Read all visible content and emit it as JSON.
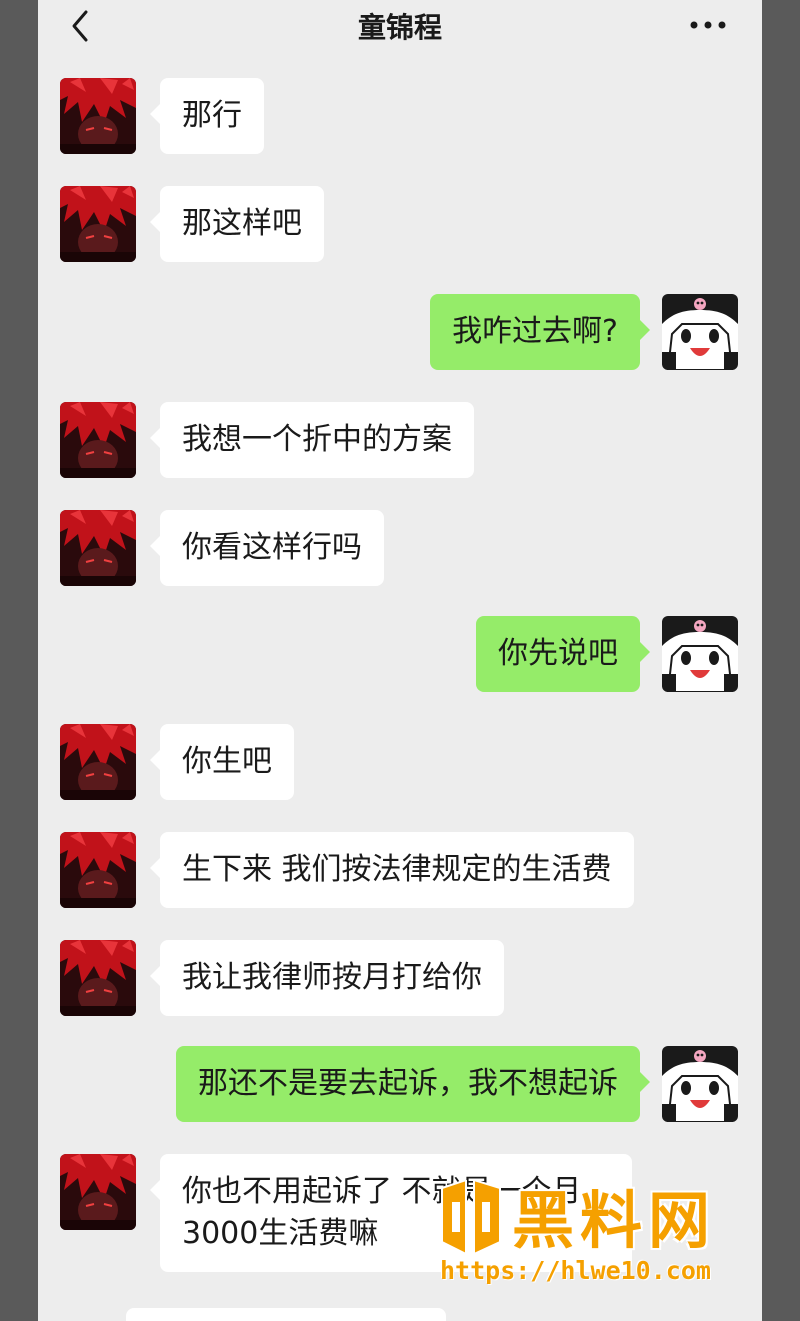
{
  "header": {
    "title": "童锦程",
    "back_icon": "chevron-left-icon",
    "more_icon": "more-dots-icon"
  },
  "colors": {
    "background": "#ededed",
    "received_bubble": "#ffffff",
    "sent_bubble": "#95ec69",
    "watermark": "#f5a000"
  },
  "messages": [
    {
      "sender": "contact",
      "text": "那行"
    },
    {
      "sender": "contact",
      "text": "那这样吧"
    },
    {
      "sender": "me",
      "text": "我咋过去啊?"
    },
    {
      "sender": "contact",
      "text": "我想一个折中的方案"
    },
    {
      "sender": "contact",
      "text": "你看这样行吗"
    },
    {
      "sender": "me",
      "text": "你先说吧"
    },
    {
      "sender": "contact",
      "text": "你生吧"
    },
    {
      "sender": "contact",
      "text": "生下来 我们按法律规定的生活费"
    },
    {
      "sender": "contact",
      "text": "我让我律师按月打给你"
    },
    {
      "sender": "me",
      "text": "那还不是要去起诉，我不想起诉"
    },
    {
      "sender": "contact",
      "text_line1": "你也不用起诉了 不就是一个月",
      "text_line2": "3000生活费嘛"
    }
  ],
  "watermark": {
    "title": "黑料网",
    "url": "https://hlwe10.com"
  }
}
